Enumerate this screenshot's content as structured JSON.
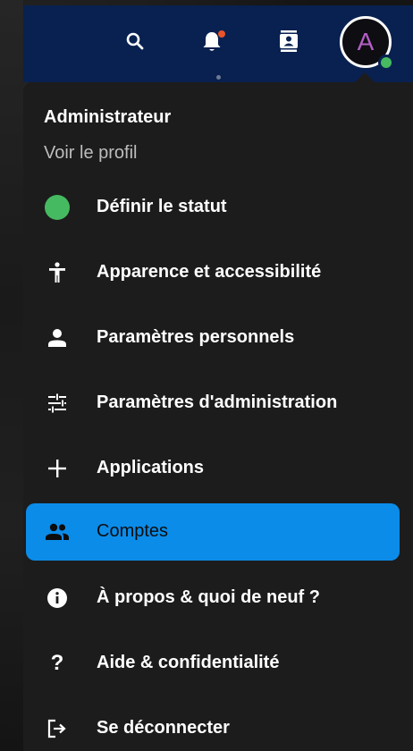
{
  "header": {
    "search_icon": "search-icon",
    "notifications_icon": "bell-icon",
    "contacts_icon": "contacts-icon",
    "avatar_letter": "A",
    "colors": {
      "header_bg": "#082150",
      "avatar_letter": "#b45fc6",
      "online_status": "#46ba61",
      "notification_dot": "#e9542b"
    }
  },
  "menu": {
    "user_name": "Administrateur",
    "view_profile": "Voir le profil",
    "items": [
      {
        "label": "Définir le statut",
        "icon": "status-dot-icon"
      },
      {
        "label": "Apparence et accessibilité",
        "icon": "accessibility-icon"
      },
      {
        "label": "Paramètres personnels",
        "icon": "person-icon"
      },
      {
        "label": "Paramètres d'administration",
        "icon": "sliders-icon"
      },
      {
        "label": "Applications",
        "icon": "plus-icon"
      },
      {
        "label": "Comptes",
        "icon": "people-icon",
        "active": true
      },
      {
        "label": "À propos & quoi de neuf ?",
        "icon": "info-icon"
      },
      {
        "label": "Aide & confidentialité",
        "icon": "question-icon"
      },
      {
        "label": "Se déconnecter",
        "icon": "logout-icon"
      }
    ],
    "active_color": "#0b8ce9"
  }
}
